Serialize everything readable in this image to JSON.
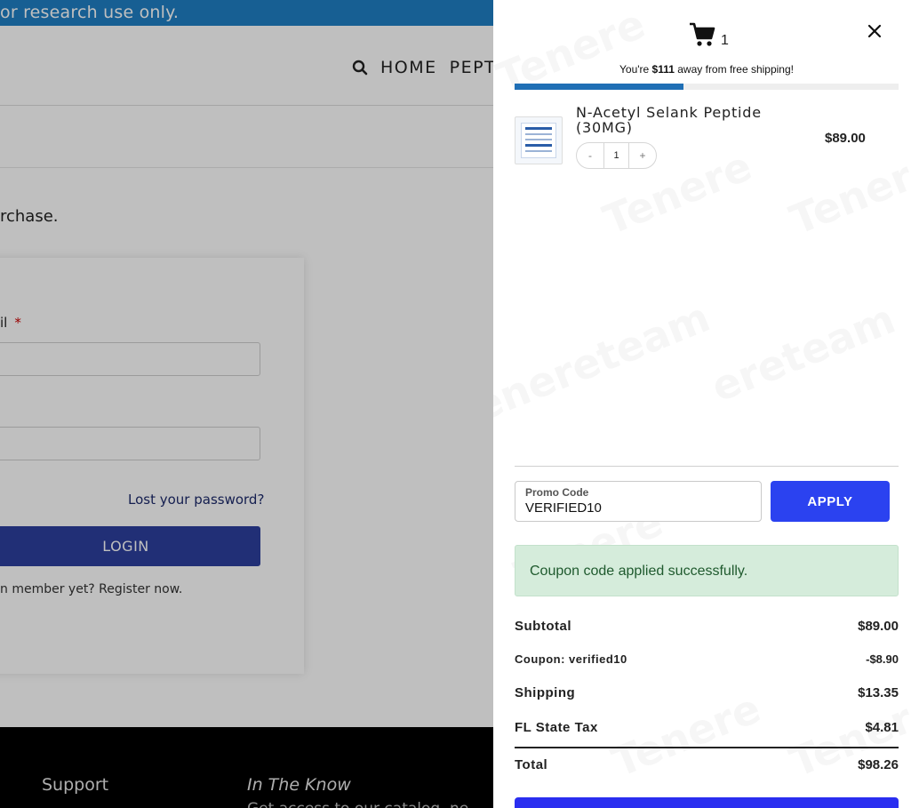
{
  "background_page": {
    "topbar_text": "or research use only.",
    "nav": {
      "home": "HOME",
      "peptides": "PEPT"
    },
    "purchase_text": "rchase.",
    "email_label": "il",
    "required_mark": "*",
    "lost_password": "Lost your password?",
    "login_button": "LOGIN",
    "register_text": "n member yet? Register now.",
    "footer": {
      "support": "Support",
      "in_the_know": "In The Know",
      "tagline": "Get access to our catalog, ne"
    }
  },
  "watermarks": [
    "Tenere",
    "Tenere",
    "Tenere",
    "enereteam",
    "ereteam",
    "Tenere",
    "Tenere",
    "Tenere"
  ],
  "cart": {
    "count": "1",
    "shipping_prefix": "You're ",
    "shipping_amount": "$111",
    "shipping_suffix": " away from free shipping!",
    "shipping_progress": 0.44,
    "colors": {
      "progress": "#1f6fb5",
      "apply": "#2b42f0",
      "success_bg": "#d5ecdb",
      "success_text": "#1f5a2e"
    },
    "item": {
      "title": "N-Acetyl Selank Peptide (30MG)",
      "quantity": "1",
      "minus": "-",
      "plus": "+",
      "price": "$89.00"
    },
    "promo": {
      "label": "Promo Code",
      "value": "VERIFIED10",
      "apply": "APPLY"
    },
    "success_message": "Coupon code applied successfully.",
    "summary": {
      "subtotal_label": "Subtotal",
      "subtotal": "$89.00",
      "coupon_label": "Coupon: verified10",
      "coupon": "-$8.90",
      "shipping_label": "Shipping",
      "shipping": "$13.35",
      "tax_label": "FL State Tax",
      "tax": "$4.81",
      "total_label": "Total",
      "total": "$98.26"
    }
  }
}
